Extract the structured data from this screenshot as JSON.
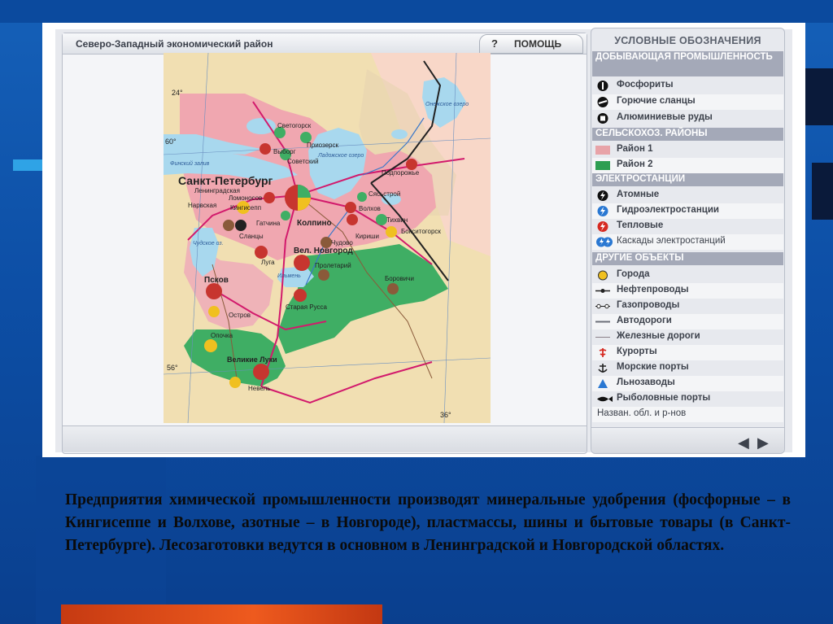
{
  "map_panel": {
    "title": "Северо-Западный экономический район",
    "help_icon": "?",
    "help_label": "ПОМОЩЬ"
  },
  "map": {
    "labels": [
      "Санкт-Петербург",
      "Светогорск",
      "Приозерск",
      "Выборг",
      "Советский",
      "Ленинградская",
      "Ломоносов",
      "Кингисепп",
      "Нарвская",
      "Сланцы",
      "Гатчина",
      "Колпино",
      "Сясьстрой",
      "Волхов",
      "Подпорожье",
      "Тихвин",
      "Бокситогорск",
      "Кириши",
      "Чудово",
      "Вел. Новгород",
      "Пролетарий",
      "Боровичи",
      "Луга",
      "Псков",
      "Остров",
      "Старая Русса",
      "Опочка",
      "Великие Луки",
      "Невель",
      "Ладожское озеро",
      "Онежское озеро",
      "Финский залив",
      "Чудское оз.",
      "Ильмень",
      "24°",
      "36°",
      "60°",
      "56°"
    ]
  },
  "legend": {
    "title": "УСЛОВНЫЕ ОБОЗНАЧЕНИЯ",
    "sections": {
      "mining": "ДОБЫВАЮЩАЯ ПРОМЫШЛЕННОСТЬ",
      "agri": "СЕЛЬСКОХОЗ. РАЙОНЫ",
      "power": "ЭЛЕКТРОСТАНЦИИ",
      "other": "ДРУГИЕ ОБЪЕКТЫ"
    },
    "items": {
      "phosphorites": "Фосфориты",
      "shale": "Горючие сланцы",
      "aluminium": "Алюминиевые руды",
      "region1": "Район 1",
      "region2": "Район 2",
      "nuclear": "Атомные",
      "hydro": "Гидроэлектростанции",
      "thermal": "Тепловые",
      "cascades": "Каскады электростанций",
      "cities": "Города",
      "oil_pipelines": "Нефтепроводы",
      "gas_pipelines": "Газопроводы",
      "roads": "Автодороги",
      "railways": "Железные дороги",
      "resorts": "Курорты",
      "sea_ports": "Морские порты",
      "flax": "Льнозаводы",
      "fishing_ports": "Рыболовные порты",
      "region_names": "Назван. обл. и р-нов"
    },
    "colors": {
      "region1": "#e8a3a8",
      "region2": "#2e9e52"
    }
  },
  "caption": "Предприятия химической промышленности производят минеральные удобрения (фосфорные – в Кингисеппе и Волхове, азотные – в Новгороде), пластмассы, шины и бытовые товары (в Санкт-Петербурге). Лесозаготовки ведутся в основном в Ленинградской и Новгородской областях."
}
